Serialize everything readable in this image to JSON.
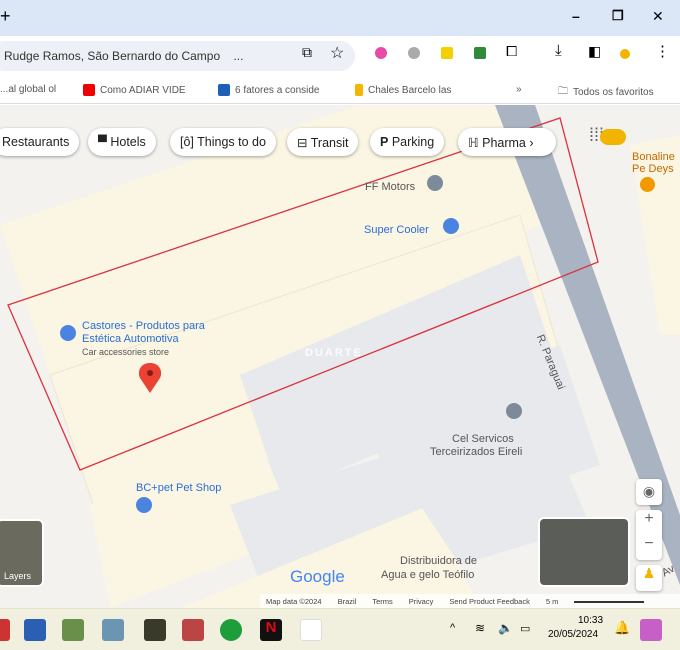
{
  "window": {
    "new_tab": "+",
    "minimize": "–",
    "restore": "❐",
    "close": "✕"
  },
  "toolbar": {
    "address": "Rudge Ramos, São Bernardo do Campo",
    "ellipsis": "..."
  },
  "bookmarks": {
    "items": [
      {
        "label": "...al global ol"
      },
      {
        "label": "Como ADIAR VIDE"
      },
      {
        "label": "6 fatores a conside"
      },
      {
        "label": "Chales Barcelo las"
      }
    ],
    "more": "»",
    "other": "Todos os favoritos"
  },
  "chips": [
    {
      "icon": "🍴",
      "label": "Restaurants"
    },
    {
      "icon": "▀",
      "label": "Hotels"
    },
    {
      "icon": "[ô]",
      "label": "Things to do"
    },
    {
      "icon": "⊟",
      "label": "Transit"
    },
    {
      "icon": "P",
      "label": "Parking"
    },
    {
      "icon": "ℍ",
      "label": "Pharma"
    }
  ],
  "chips_next": "›",
  "places": [
    {
      "name": "FF Motors"
    },
    {
      "name": "Super Cooler"
    },
    {
      "name": "Castores - Produtos para Estética Automotiva",
      "line1": "Castores - Produtos para",
      "line2": "Estética Automotiva",
      "sub": "Car accessories store"
    },
    {
      "name": "Cel Servicos Terceirizados Eireli",
      "line1": "Cel Servicos",
      "line2": "Terceirizados Eireli"
    },
    {
      "name": "BC+pet Pet Shop"
    },
    {
      "name": "Distribuidora de Agua e gelo Teófilo",
      "line1": "Distribuidora de",
      "line2": "Agua e gelo Teófilo"
    },
    {
      "name": "Bonaline Pe Deys",
      "line1": "Bonalin",
      "line2": "Pe Deys"
    }
  ],
  "street": "R. Paraguai",
  "street2": "Av",
  "watermark": "DUARTE",
  "layers": "Layers",
  "google": "Google",
  "footer": {
    "mapdata": "Map data ©2024",
    "brazil": "Brazil",
    "terms": "Terms",
    "privacy": "Privacy",
    "feedback": "Send Product Feedback",
    "scale": "5 m"
  },
  "zoom": {
    "in": "+",
    "out": "−"
  },
  "clock": {
    "time": "10:33",
    "date": "20/05/2024"
  },
  "colors": {
    "polygon": "#d9333f",
    "pin": "#ea4335",
    "road": "#a9b3c1"
  }
}
